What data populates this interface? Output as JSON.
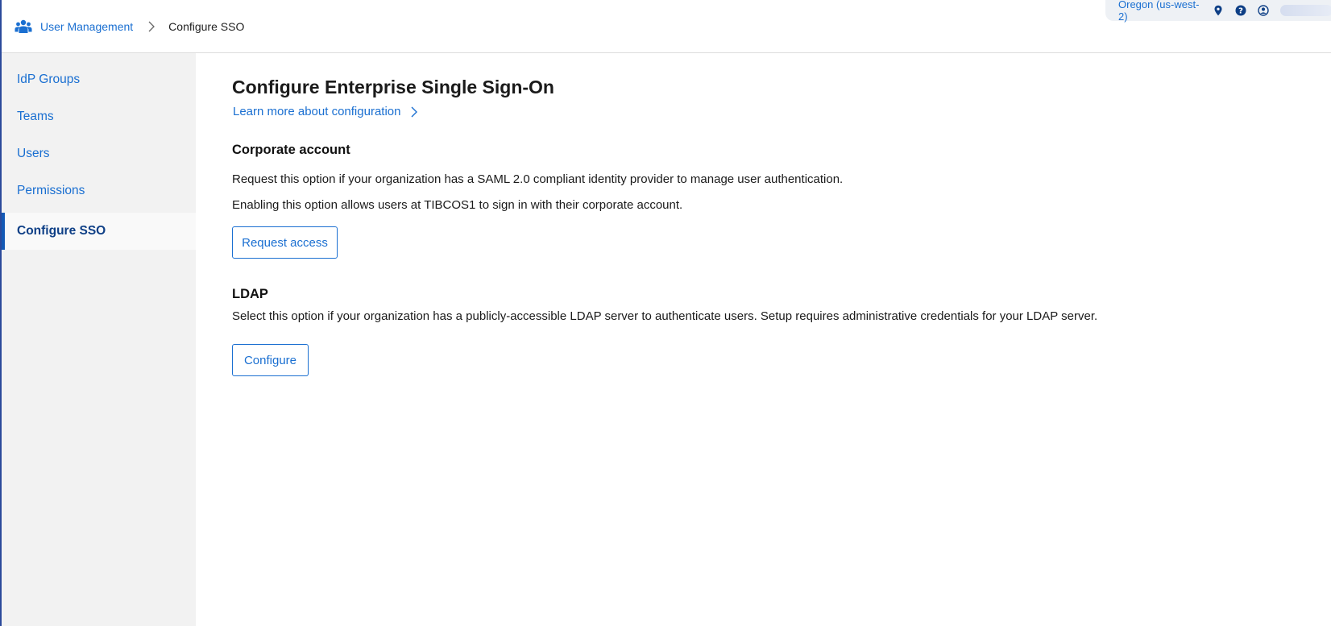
{
  "breadcrumb": {
    "icon": "users-group-icon",
    "parent": "User Management",
    "separator_icon": "chevron-right-icon",
    "current": "Configure SSO"
  },
  "header": {
    "region": "Oregon (us-west-2)",
    "icons": [
      "location-pin-icon",
      "help-icon",
      "user-avatar-icon"
    ]
  },
  "sidebar": {
    "items": [
      {
        "label": "IdP Groups",
        "active": false
      },
      {
        "label": "Teams",
        "active": false
      },
      {
        "label": "Users",
        "active": false
      },
      {
        "label": "Permissions",
        "active": false
      },
      {
        "label": "Configure SSO",
        "active": true
      }
    ]
  },
  "main": {
    "title": "Configure Enterprise Single Sign-On",
    "learn_more": "Learn more about configuration",
    "corporate": {
      "heading": "Corporate account",
      "line1": "Request this option if your organization has a SAML 2.0 compliant identity provider to manage user authentication.",
      "line2": "Enabling this option allows users at TIBCOS1 to sign in with their corporate account.",
      "button": "Request access"
    },
    "ldap": {
      "heading": "LDAP",
      "line1": "Select this option if your organization has a publicly-accessible LDAP server to authenticate users. Setup requires administrative credentials for your LDAP server.",
      "button": "Configure"
    }
  },
  "colors": {
    "accent": "#1a6fd1",
    "active_nav": "#0e3f86",
    "sidebar_bg": "#f2f2f2"
  }
}
